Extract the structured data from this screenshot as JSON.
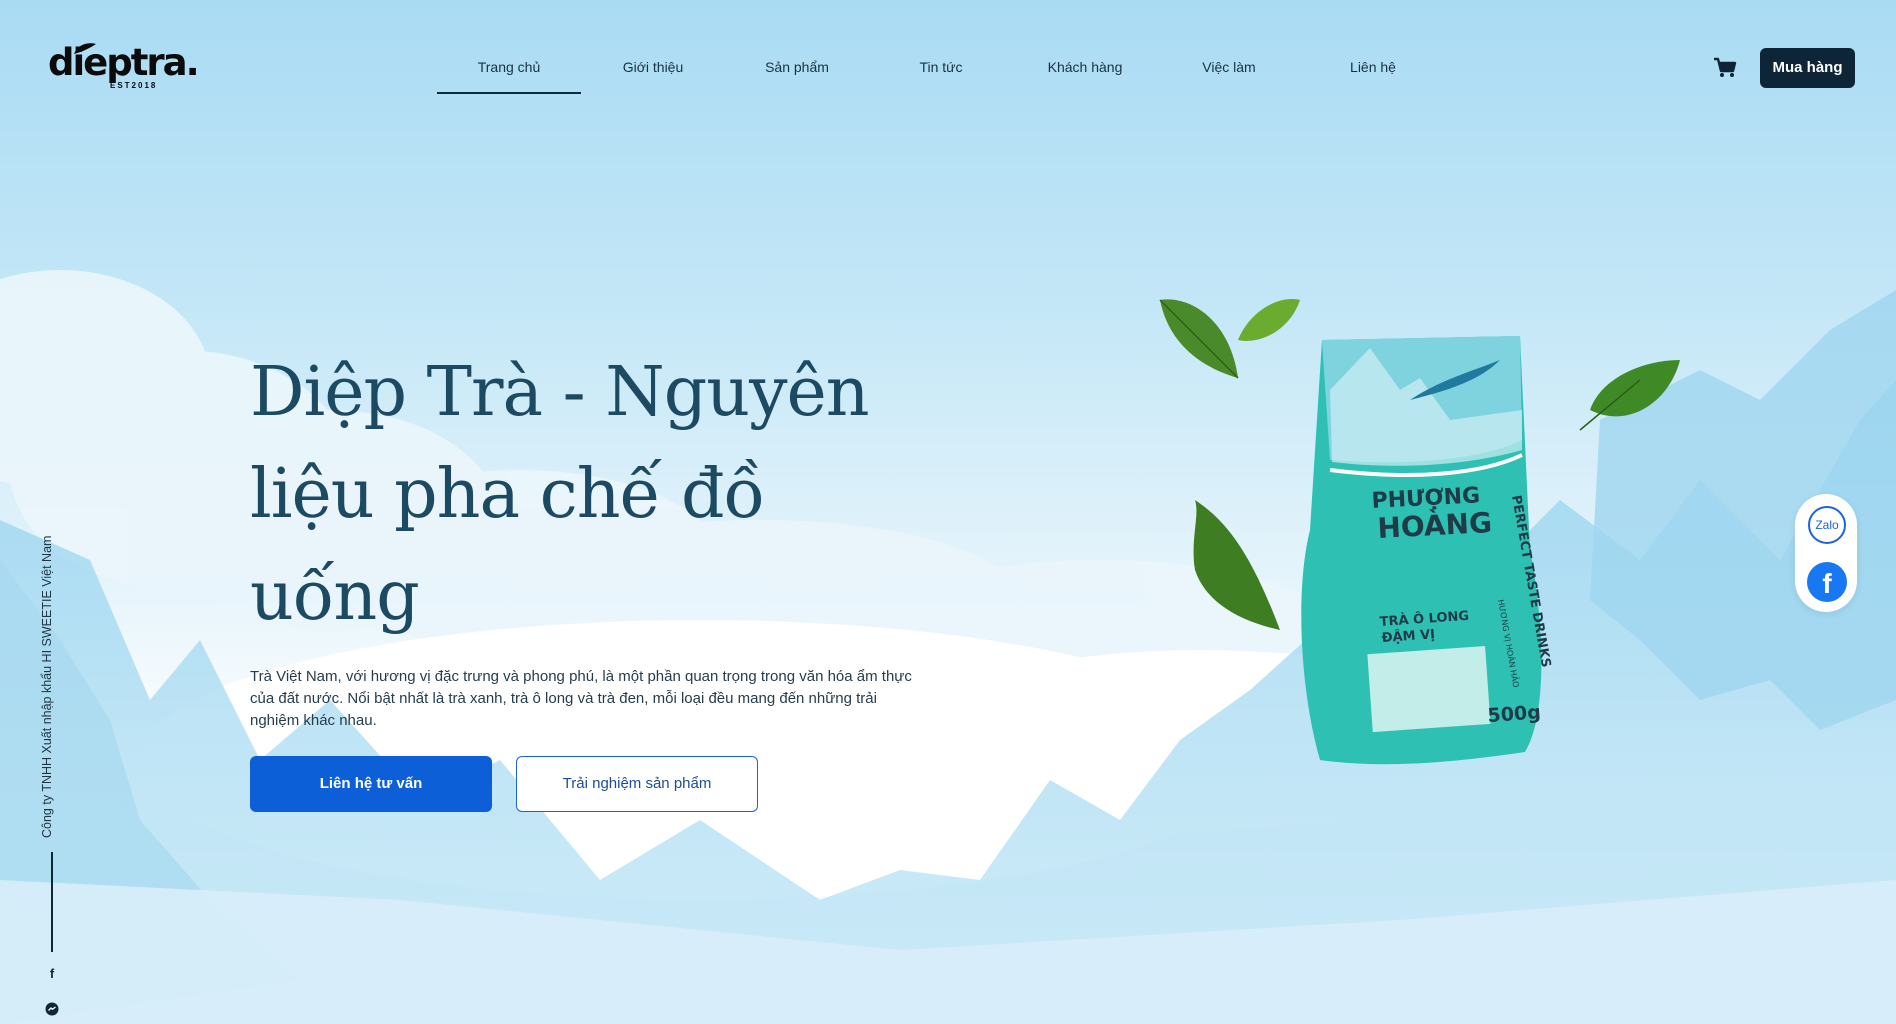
{
  "brand": {
    "logo_text": "dieptra.",
    "logo_sub": "EST2018"
  },
  "nav": {
    "items": [
      {
        "label": "Trang chủ",
        "active": true
      },
      {
        "label": "Giới thiệu"
      },
      {
        "label": "Sản phẩm"
      },
      {
        "label": "Tin tức"
      },
      {
        "label": "Khách hàng"
      },
      {
        "label": "Việc làm"
      },
      {
        "label": "Liên hệ"
      }
    ],
    "buy_label": "Mua hàng",
    "cart_icon": "cart-icon"
  },
  "hero": {
    "title_line1": "Diệp Trà - Nguyên",
    "title_line2": "liệu pha chế đồ uống",
    "description": "Trà Việt Nam, với hương vị đặc trưng và phong phú, là một phần quan trọng trong văn hóa ẩm thực của đất nước. Nổi bật nhất là trà xanh, trà ô long và trà đen, mỗi loại đều mang đến những trải nghiệm khác nhau.",
    "primary_cta": "Liên hệ tư vấn",
    "secondary_cta": "Trải nghiệm sản phẩm"
  },
  "product": {
    "brand_line1": "PHƯỢNG",
    "brand_line2": "HOÀNG",
    "tagline": "PERFECT TASTE DRINKS",
    "subtag": "HƯƠNG VỊ HOÀN HẢO",
    "name_line1": "TRÀ Ô LONG",
    "name_line2": "ĐẬM VỊ",
    "weight": "500g"
  },
  "side": {
    "company": "Công ty TNHH Xuất nhập khẩu HI SWEETIE Việt Nam",
    "fb_glyph": "f"
  },
  "social": {
    "zalo_label": "Zalo",
    "facebook_glyph": "f"
  },
  "colors": {
    "primary": "#0d5fd8",
    "dark": "#0d2536",
    "title": "#1c4a63",
    "package": "#2fc0b4"
  }
}
